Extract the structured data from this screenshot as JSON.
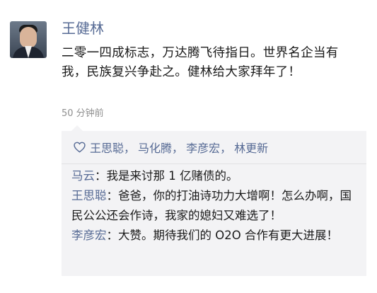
{
  "user": {
    "name": "王健林"
  },
  "post": {
    "text": "二零一四成标志，万达腾飞待指日。世界名企当有我，民族复兴争赴之。健林给大家拜年了！",
    "time": "50 分钟前"
  },
  "likes": {
    "icon": "heart-icon",
    "names": [
      "王思聪",
      "马化腾",
      "李彦宏",
      "林更新"
    ],
    "separator": "，"
  },
  "comments": [
    {
      "author": "马云",
      "colon": "：",
      "text": "我是来讨那 1 亿赌债的。"
    },
    {
      "author": "王思聪",
      "colon": "：",
      "text": "爸爸，你的打油诗功力大增啊！怎么办啊，国民公公还会作诗，我家的媳妇又难选了！"
    },
    {
      "author": "李彦宏",
      "colon": "：",
      "text": "大赞。期待我们的 O2O 合作有更大进展！"
    }
  ],
  "colors": {
    "link": "#576b95",
    "panel": "#f3f3f5",
    "time": "#8f8f8f"
  }
}
